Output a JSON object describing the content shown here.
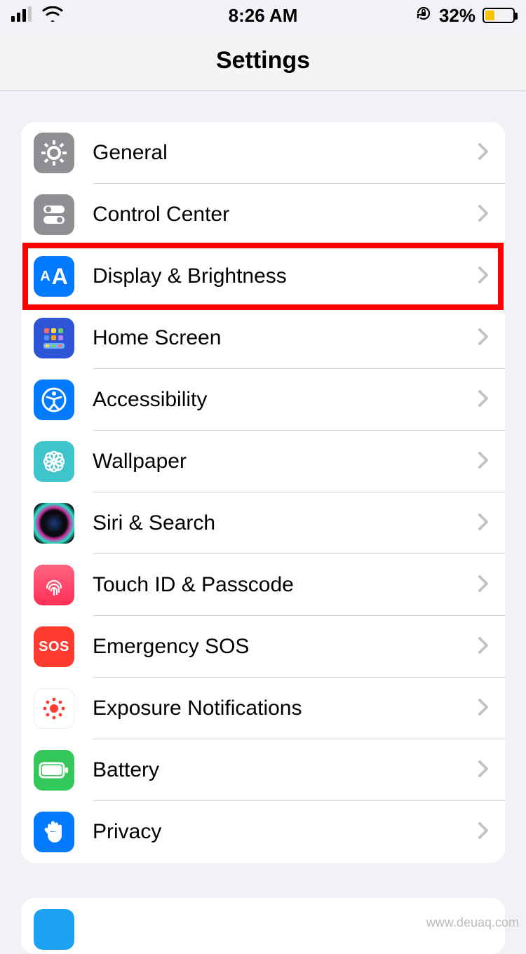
{
  "status": {
    "time": "8:26 AM",
    "battery_text": "32%",
    "battery_level": 32
  },
  "nav": {
    "title": "Settings"
  },
  "rows": [
    {
      "label": "General"
    },
    {
      "label": "Control Center"
    },
    {
      "label": "Display & Brightness"
    },
    {
      "label": "Home Screen"
    },
    {
      "label": "Accessibility"
    },
    {
      "label": "Wallpaper"
    },
    {
      "label": "Siri & Search"
    },
    {
      "label": "Touch ID & Passcode"
    },
    {
      "label": "Emergency SOS"
    },
    {
      "label": "Exposure Notifications"
    },
    {
      "label": "Battery"
    },
    {
      "label": "Privacy"
    }
  ],
  "sos_text": "SOS",
  "watermark": "www.deuaq.com",
  "highlight_index": 2
}
